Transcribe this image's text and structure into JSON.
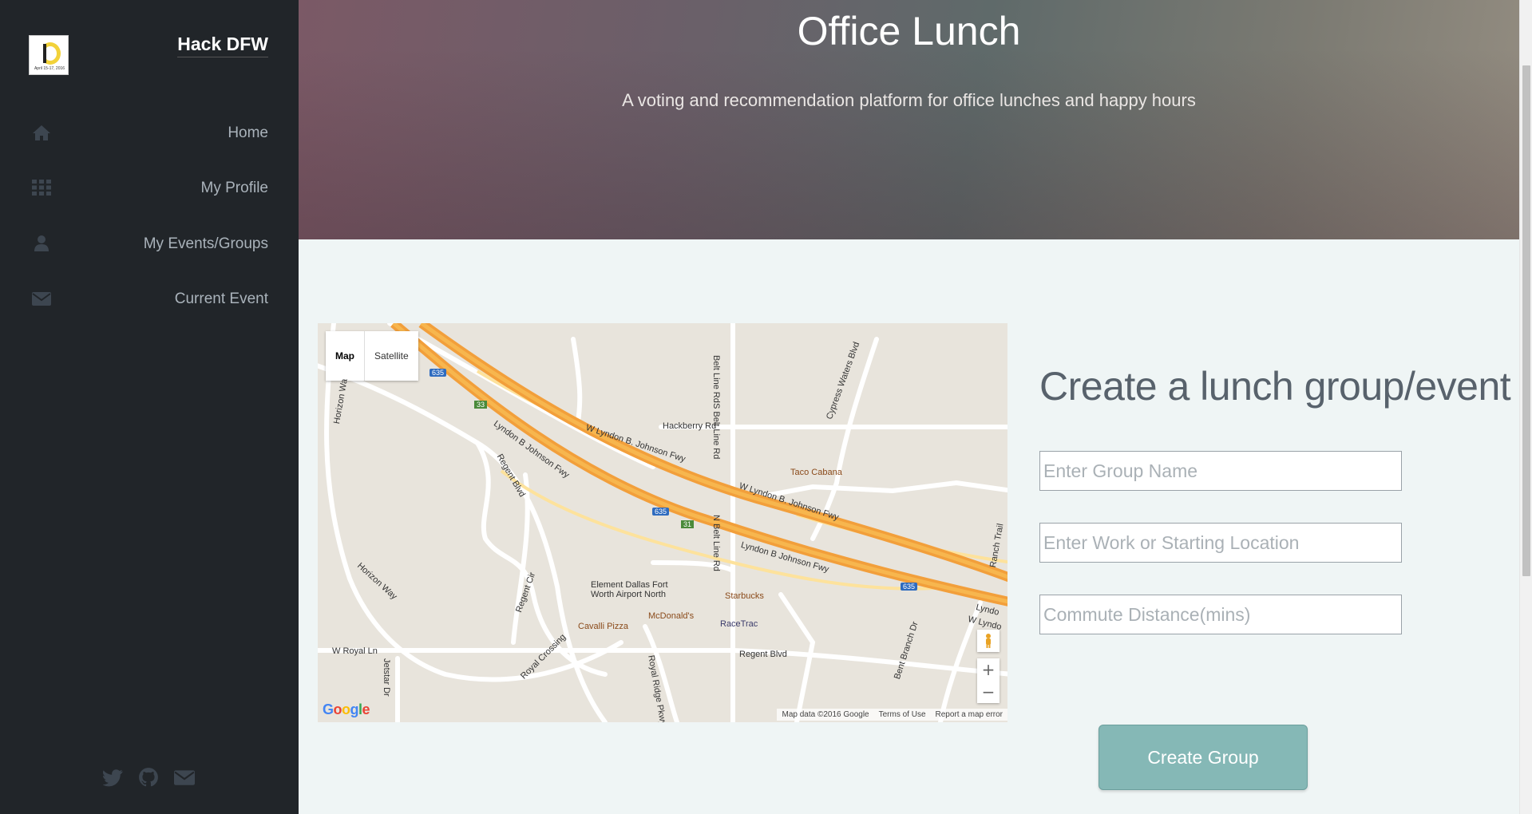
{
  "sidebar": {
    "brand_name": "Hack DFW",
    "logo_text": "April 15-17, 2016",
    "items": [
      {
        "label": "Home",
        "icon": "home-icon"
      },
      {
        "label": "My Profile",
        "icon": "grid-icon"
      },
      {
        "label": "My Events/Groups",
        "icon": "user-icon"
      },
      {
        "label": "Current Event",
        "icon": "envelope-icon"
      }
    ],
    "social": [
      "twitter-icon",
      "github-icon",
      "envelope-icon"
    ]
  },
  "hero": {
    "title": "Office Lunch",
    "subtitle": "A voting and recommendation platform for office lunches and happy hours"
  },
  "map": {
    "type_map": "Map",
    "type_satellite": "Satellite",
    "zoom_in": "+",
    "zoom_out": "−",
    "attribution": "Map data ©2016 Google",
    "terms": "Terms of Use",
    "report": "Report a map error",
    "labels": {
      "belt_line_rd": "Belt Line Rd",
      "s_belt_line_rd": "S Belt Line Rd",
      "n_belt_line_rd": "N Belt Line Rd",
      "hackberry_rd": "Hackberry Rd",
      "cypress_waters": "Cypress Waters Blvd",
      "w_lyndon_1": "W Lyndon B. Johnson Fwy",
      "w_lyndon_2": "W Lyndon B. Johnson Fwy",
      "lyndon_1": "Lyndon B Johnson Fwy",
      "lyndon_2": "Lyndon B Johnson Fwy",
      "lyndo_w": "W Lyndo",
      "lyndo": "Lyndo",
      "taco_cabana": "Taco Cabana",
      "regent_blvd_1": "Regent Blvd",
      "regent_blvd_2": "Regent Blvd",
      "regent_cir": "Regent Cir",
      "horizon_way_1": "Horizon Wa",
      "horizon_way_2": "Horizon Way",
      "element_1": "Element Dallas Fort",
      "element_2": "Worth Airport North",
      "starbucks": "Starbucks",
      "mcdonalds": "McDonald's",
      "racetrac": "RaceTrac",
      "cavalli": "Cavalli Pizza",
      "royal_crossing": "Royal Crossing",
      "royal_ridge": "Royal Ridge Pkwy",
      "w_royal_ln": "W Royal Ln",
      "jetstar": "Jetstar Dr",
      "bent_branch": "Bent Branch Dr",
      "ranch_trail": "Ranch Trail",
      "shield_635": "635",
      "shield_33": "33",
      "shield_31": "31"
    }
  },
  "form": {
    "title": "Create a lunch group/event",
    "group_name_placeholder": "Enter Group Name",
    "location_placeholder": "Enter Work or Starting Location",
    "commute_placeholder": "Commute Distance(mins)",
    "submit_label": "Create Group"
  },
  "colors": {
    "sidebar_bg": "#212529",
    "accent_button": "#85b8b6",
    "page_bg": "#eff5f5"
  }
}
